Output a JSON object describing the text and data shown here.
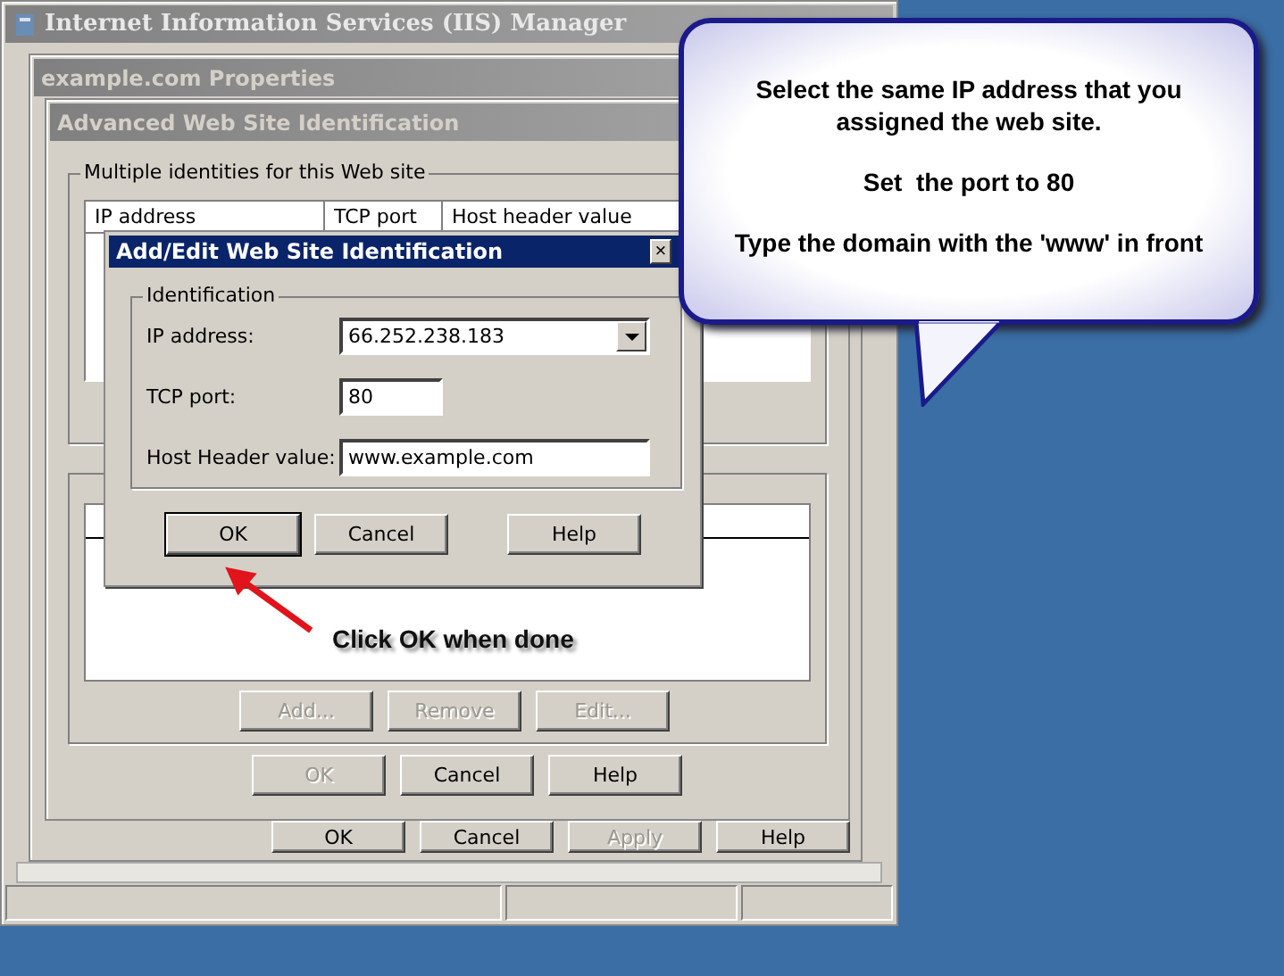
{
  "main_window": {
    "title": "Internet Information Services (IIS) Manager",
    "active": false
  },
  "properties_window": {
    "title": "example.com Properties",
    "buttons": [
      {
        "label": "OK",
        "disabled": false
      },
      {
        "label": "Cancel",
        "disabled": false
      },
      {
        "label": "Apply",
        "disabled": true
      },
      {
        "label": "Help",
        "disabled": false
      }
    ]
  },
  "advanced_window": {
    "title": "Advanced Web Site Identification",
    "group_label": "Multiple identities for this Web site",
    "table": {
      "columns": [
        "IP address",
        "TCP port",
        "Host header value"
      ]
    },
    "list_buttons": [
      {
        "label": "Add...",
        "disabled": true
      },
      {
        "label": "Remove",
        "disabled": true
      },
      {
        "label": "Edit...",
        "disabled": true
      }
    ],
    "buttons": [
      {
        "label": "OK",
        "disabled": true
      },
      {
        "label": "Cancel",
        "disabled": false
      },
      {
        "label": "Help",
        "disabled": false
      }
    ]
  },
  "edit_dialog": {
    "title": "Add/Edit Web Site Identification",
    "close": "×",
    "group_label": "Identification",
    "fields": [
      {
        "kind": "dropdown",
        "label": "IP address:",
        "value": "66.252.238.183"
      },
      {
        "kind": "text",
        "label": "TCP port:",
        "value": "80"
      },
      {
        "kind": "text",
        "label": "Host Header value:",
        "value": "www.example.com"
      }
    ],
    "buttons": [
      {
        "label": "OK",
        "default": true
      },
      {
        "label": "Cancel",
        "default": false
      },
      {
        "label": "Help",
        "default": false
      }
    ]
  },
  "callout": {
    "lines": [
      "Select the same IP address that you assigned the web site.",
      "Set  the port to 80",
      "Type the domain with the 'www' in front"
    ]
  },
  "annotation": {
    "text": "Click OK when done"
  }
}
